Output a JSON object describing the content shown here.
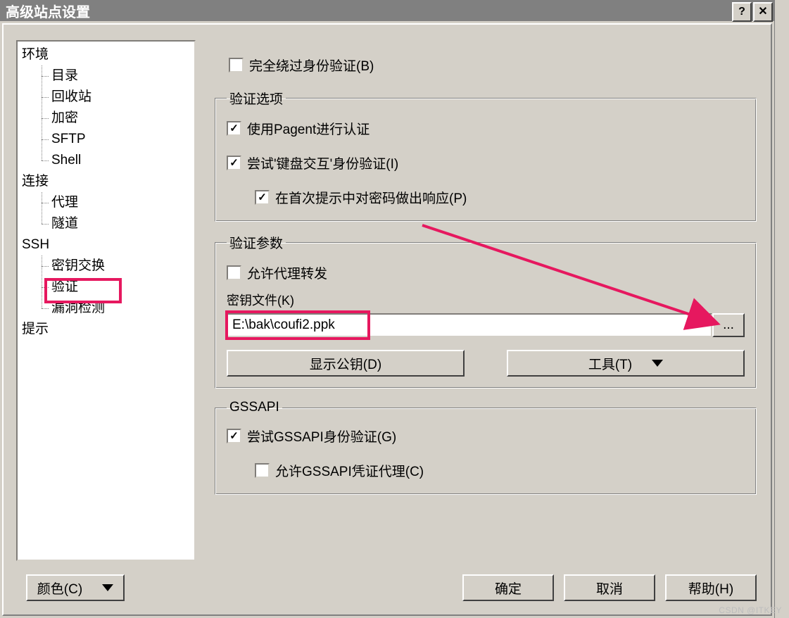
{
  "title": "高级站点设置",
  "titlebar": {
    "help": "?",
    "close": "✕"
  },
  "tree": {
    "nodes": [
      {
        "label": "环境",
        "children": [
          {
            "label": "目录"
          },
          {
            "label": "回收站"
          },
          {
            "label": "加密"
          },
          {
            "label": "SFTP"
          },
          {
            "label": "Shell"
          }
        ]
      },
      {
        "label": "连接",
        "children": [
          {
            "label": "代理"
          },
          {
            "label": "隧道"
          }
        ]
      },
      {
        "label": "SSH",
        "children": [
          {
            "label": "密钥交换"
          },
          {
            "label": "验证",
            "selected": true
          },
          {
            "label": "漏洞检测"
          }
        ]
      },
      {
        "label": "提示"
      }
    ]
  },
  "main": {
    "bypass_auth": {
      "label": "完全绕过身份验证(B)",
      "checked": false
    },
    "auth_options": {
      "legend": "验证选项",
      "pagent": {
        "label": "使用Pagent进行认证",
        "checked": true
      },
      "kbd_interactive": {
        "label": "尝试'键盘交互'身份验证(I)",
        "checked": true
      },
      "respond_password": {
        "label": "在首次提示中对密码做出响应(P)",
        "checked": true
      }
    },
    "auth_params": {
      "legend": "验证参数",
      "agent_forward": {
        "label": "允许代理转发",
        "checked": false
      },
      "key_file_label": "密钥文件(K)",
      "key_file_value": "E:\\bak\\coufi2.ppk",
      "browse": "...",
      "show_pubkey": "显示公钥(D)",
      "tools": "工具(T)"
    },
    "gssapi": {
      "legend": "GSSAPI",
      "try_gssapi": {
        "label": "尝试GSSAPI身份验证(G)",
        "checked": true
      },
      "allow_delegation": {
        "label": "允许GSSAPI凭证代理(C)",
        "checked": false
      }
    }
  },
  "footer": {
    "color": "颜色(C)",
    "ok": "确定",
    "cancel": "取消",
    "help": "帮助(H)"
  },
  "watermark": "CSDN @ITKEY"
}
